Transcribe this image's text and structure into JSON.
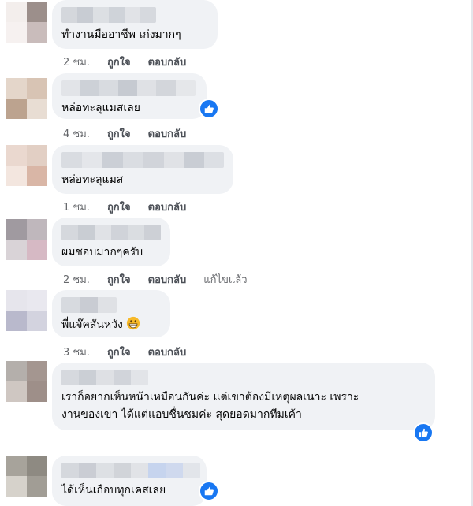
{
  "comments": [
    {
      "text": "ทำงานมืออาชีพ เก่งมากๆ",
      "time": "2 ชม.",
      "like": "ถูกใจ",
      "reply": "ตอบกลับ",
      "edited": "",
      "reaction": ""
    },
    {
      "text": "หล่อทะลุแมสเลย",
      "time": "4 ชม.",
      "like": "ถูกใจ",
      "reply": "ตอบกลับ",
      "edited": "",
      "reaction": "like-icon"
    },
    {
      "text": "หล่อทะลุแมส",
      "time": "1 ชม.",
      "like": "ถูกใจ",
      "reply": "ตอบกลับ",
      "edited": "",
      "reaction": ""
    },
    {
      "text": "ผมชอบมากๆครับ",
      "time": "2 ชม.",
      "like": "ถูกใจ",
      "reply": "ตอบกลับ",
      "edited": "แก้ไขแล้ว",
      "reaction": ""
    },
    {
      "text": "พี่แจ๊คสันหวัง",
      "time": "3 ชม.",
      "like": "ถูกใจ",
      "reply": "ตอบกลับ",
      "edited": "",
      "reaction": "",
      "emoji": "grinning-face-icon"
    },
    {
      "text": "เราก็อยากเห็นหน้าเหมือนกันค่ะ แต่เขาต้องมีเหตุผลเนาะ เพราะ\nงานของเขา ได้แต่แอบชื่นชมค่ะ สุดยอดมากทีมเค้า",
      "time": "",
      "like": "",
      "reply": "",
      "edited": "",
      "reaction": "like-icon"
    },
    {
      "text": "ได้เห็นเกือบทุกเคสเลย",
      "time": "",
      "like": "",
      "reply": "",
      "edited": "",
      "reaction": "like-icon"
    }
  ],
  "colors": {
    "bubble": "#f0f2f5",
    "like_blue": "#1877f2",
    "meta_gray": "#65676b"
  }
}
